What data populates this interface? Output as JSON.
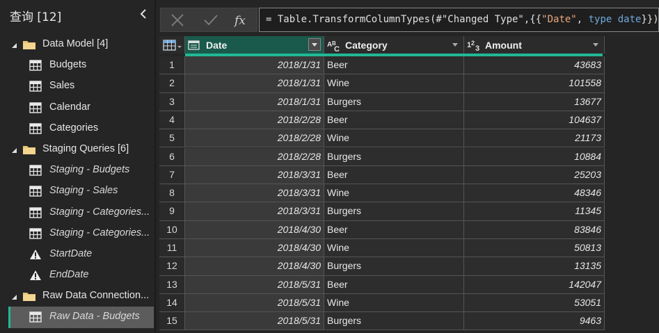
{
  "queries_pane": {
    "title": "查询 [12]",
    "groups": [
      {
        "label": "Data Model [4]",
        "items": [
          {
            "label": "Budgets",
            "icon": "table-icon",
            "italic": false
          },
          {
            "label": "Sales",
            "icon": "table-icon",
            "italic": false
          },
          {
            "label": "Calendar",
            "icon": "table-icon",
            "italic": false
          },
          {
            "label": "Categories",
            "icon": "table-icon",
            "italic": false
          }
        ]
      },
      {
        "label": "Staging Queries [6]",
        "items": [
          {
            "label": "Staging - Budgets",
            "icon": "table-icon",
            "italic": true
          },
          {
            "label": "Staging - Sales",
            "icon": "table-icon",
            "italic": true
          },
          {
            "label": "Staging - Categories...",
            "icon": "table-icon",
            "italic": true
          },
          {
            "label": "Staging - Categories...",
            "icon": "table-icon",
            "italic": true
          },
          {
            "label": "StartDate",
            "icon": "warning-icon",
            "italic": true
          },
          {
            "label": "EndDate",
            "icon": "warning-icon",
            "italic": true
          }
        ]
      },
      {
        "label": "Raw Data Connection...",
        "items": [
          {
            "label": "Raw Data - Budgets",
            "icon": "table-icon",
            "italic": true,
            "selected": true
          }
        ]
      }
    ]
  },
  "formula_bar": {
    "prefix": "= Table.TransformColumnTypes(#\"Changed Type\",{{",
    "str": "\"Date\"",
    "mid": ", ",
    "kw": "type date",
    "suffix": "}})"
  },
  "grid": {
    "columns": [
      {
        "label": "Date",
        "type_icon": "calendar-type-icon"
      },
      {
        "label": "Category",
        "type_icon": "text-type-icon"
      },
      {
        "label": "Amount",
        "type_icon": "number-type-icon"
      }
    ],
    "rows": [
      {
        "n": "1",
        "date": "2018/1/31",
        "category": "Beer",
        "amount": "43683"
      },
      {
        "n": "2",
        "date": "2018/1/31",
        "category": "Wine",
        "amount": "101558"
      },
      {
        "n": "3",
        "date": "2018/1/31",
        "category": "Burgers",
        "amount": "13677"
      },
      {
        "n": "4",
        "date": "2018/2/28",
        "category": "Beer",
        "amount": "104637"
      },
      {
        "n": "5",
        "date": "2018/2/28",
        "category": "Wine",
        "amount": "21173"
      },
      {
        "n": "6",
        "date": "2018/2/28",
        "category": "Burgers",
        "amount": "10884"
      },
      {
        "n": "7",
        "date": "2018/3/31",
        "category": "Beer",
        "amount": "25203"
      },
      {
        "n": "8",
        "date": "2018/3/31",
        "category": "Wine",
        "amount": "48346"
      },
      {
        "n": "9",
        "date": "2018/3/31",
        "category": "Burgers",
        "amount": "11345"
      },
      {
        "n": "10",
        "date": "2018/4/30",
        "category": "Beer",
        "amount": "83846"
      },
      {
        "n": "11",
        "date": "2018/4/30",
        "category": "Wine",
        "amount": "50813"
      },
      {
        "n": "12",
        "date": "2018/4/30",
        "category": "Burgers",
        "amount": "13135"
      },
      {
        "n": "13",
        "date": "2018/5/31",
        "category": "Beer",
        "amount": "142047"
      },
      {
        "n": "14",
        "date": "2018/5/31",
        "category": "Wine",
        "amount": "53051"
      },
      {
        "n": "15",
        "date": "2018/5/31",
        "category": "Burgers",
        "amount": "9463"
      }
    ]
  },
  "colors": {
    "accent": "#21b895",
    "selected_header": "#1a5a4c",
    "folder": "#e8c77a"
  }
}
